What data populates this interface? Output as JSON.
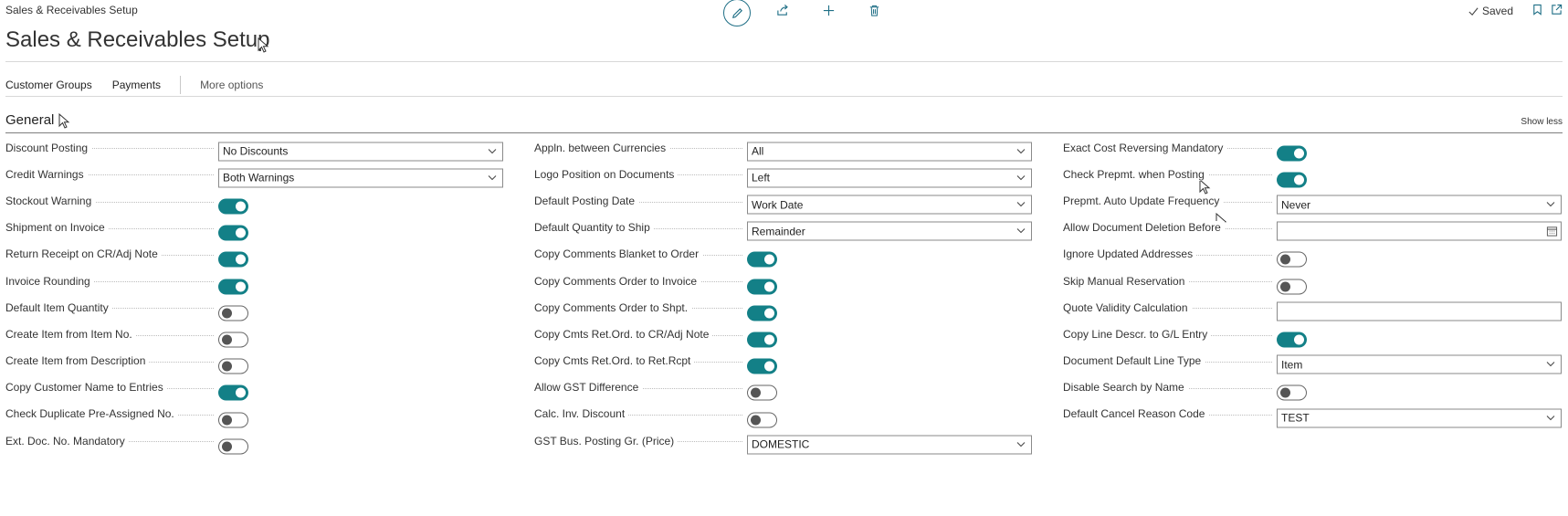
{
  "header": {
    "breadcrumb": "Sales & Receivables Setup",
    "title": "Sales & Receivables Setup",
    "saved_label": "Saved"
  },
  "toolbar": {
    "icons": [
      "edit-icon",
      "share-icon",
      "add-icon",
      "delete-icon"
    ]
  },
  "actions": {
    "customer_groups": "Customer Groups",
    "payments": "Payments",
    "more_options": "More options"
  },
  "section": {
    "title": "General",
    "show_less": "Show less"
  },
  "col1": [
    {
      "label": "Discount Posting",
      "type": "select",
      "value": "No Discounts"
    },
    {
      "label": "Credit Warnings",
      "type": "select",
      "value": "Both Warnings"
    },
    {
      "label": "Stockout Warning",
      "type": "toggle",
      "value": true
    },
    {
      "label": "Shipment on Invoice",
      "type": "toggle",
      "value": true
    },
    {
      "label": "Return Receipt on CR/Adj Note",
      "type": "toggle",
      "value": true
    },
    {
      "label": "Invoice Rounding",
      "type": "toggle",
      "value": true
    },
    {
      "label": "Default Item Quantity",
      "type": "toggle",
      "value": false
    },
    {
      "label": "Create Item from Item No.",
      "type": "toggle",
      "value": false
    },
    {
      "label": "Create Item from Description",
      "type": "toggle",
      "value": false
    },
    {
      "label": "Copy Customer Name to Entries",
      "type": "toggle",
      "value": true
    },
    {
      "label": "Check Duplicate Pre-Assigned No.",
      "type": "toggle",
      "value": false
    },
    {
      "label": "Ext. Doc. No. Mandatory",
      "type": "toggle",
      "value": false
    }
  ],
  "col2": [
    {
      "label": "Appln. between Currencies",
      "type": "select",
      "value": "All"
    },
    {
      "label": "Logo Position on Documents",
      "type": "select",
      "value": "Left"
    },
    {
      "label": "Default Posting Date",
      "type": "select",
      "value": "Work Date"
    },
    {
      "label": "Default Quantity to Ship",
      "type": "select",
      "value": "Remainder"
    },
    {
      "label": "Copy Comments Blanket to Order",
      "type": "toggle",
      "value": true
    },
    {
      "label": "Copy Comments Order to Invoice",
      "type": "toggle",
      "value": true
    },
    {
      "label": "Copy Comments Order to Shpt.",
      "type": "toggle",
      "value": true
    },
    {
      "label": "Copy Cmts Ret.Ord. to CR/Adj Note",
      "type": "toggle",
      "value": true
    },
    {
      "label": "Copy Cmts Ret.Ord. to Ret.Rcpt",
      "type": "toggle",
      "value": true
    },
    {
      "label": "Allow GST Difference",
      "type": "toggle",
      "value": false
    },
    {
      "label": "Calc. Inv. Discount",
      "type": "toggle",
      "value": false
    },
    {
      "label": "GST Bus. Posting Gr. (Price)",
      "type": "select",
      "value": "DOMESTIC"
    }
  ],
  "col3": [
    {
      "label": "Exact Cost Reversing Mandatory",
      "type": "toggle",
      "value": true
    },
    {
      "label": "Check Prepmt. when Posting",
      "type": "toggle",
      "value": true
    },
    {
      "label": "Prepmt. Auto Update Frequency",
      "type": "select",
      "value": "Never"
    },
    {
      "label": "Allow Document Deletion Before",
      "type": "date",
      "value": ""
    },
    {
      "label": "Ignore Updated Addresses",
      "type": "toggle",
      "value": false
    },
    {
      "label": "Skip Manual Reservation",
      "type": "toggle",
      "value": false
    },
    {
      "label": "Quote Validity Calculation",
      "type": "text",
      "value": ""
    },
    {
      "label": "Copy Line Descr. to G/L Entry",
      "type": "toggle",
      "value": true
    },
    {
      "label": "Document Default Line Type",
      "type": "select",
      "value": "Item"
    },
    {
      "label": "Disable Search by Name",
      "type": "toggle",
      "value": false
    },
    {
      "label": "Default Cancel Reason Code",
      "type": "select",
      "value": "TEST"
    }
  ]
}
